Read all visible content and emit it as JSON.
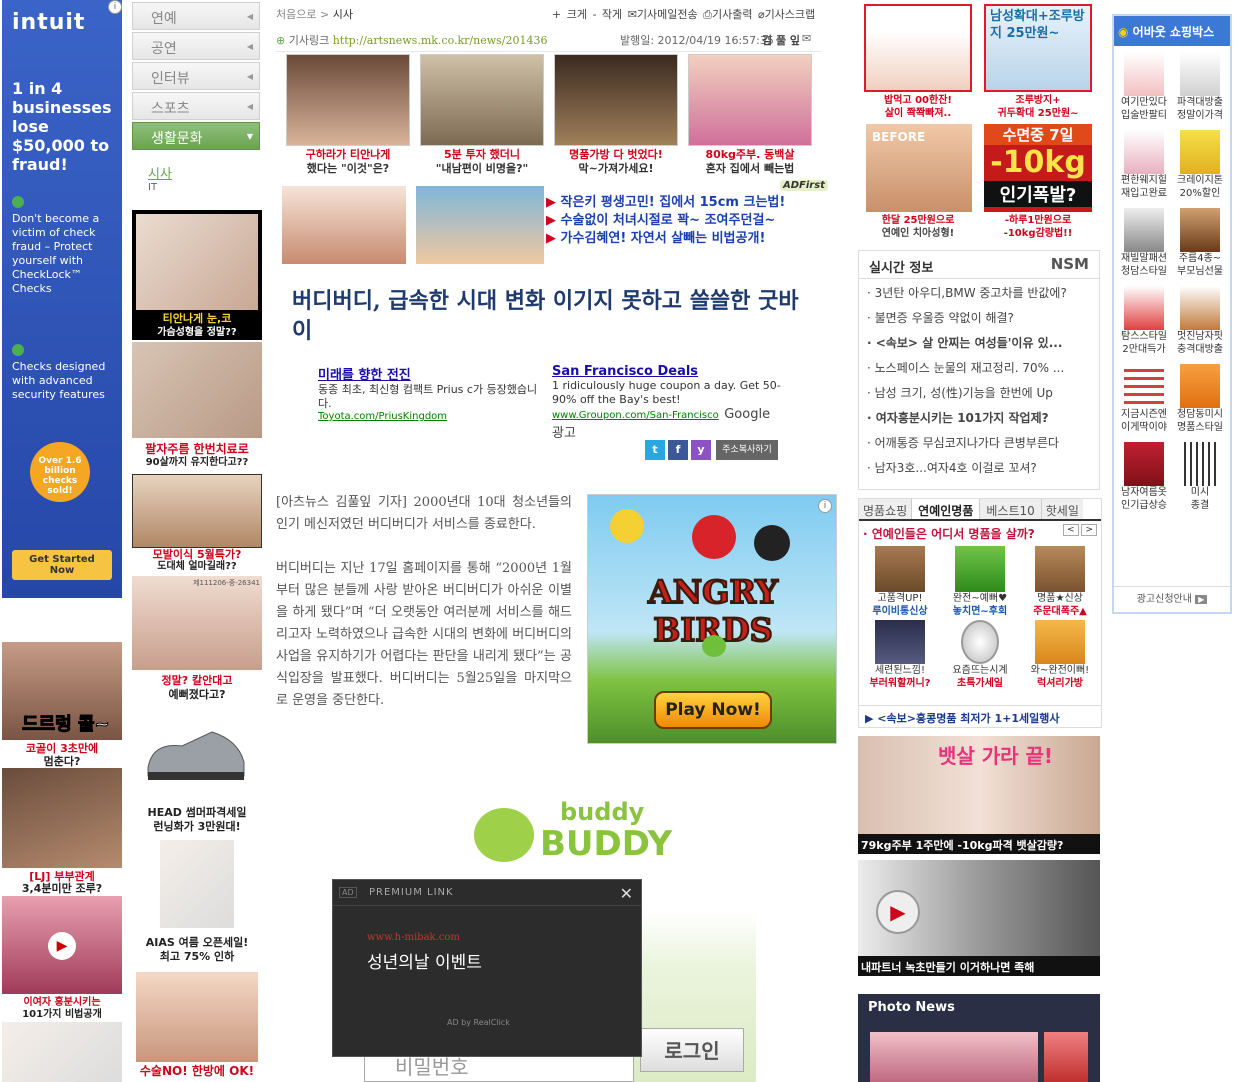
{
  "left_ad": {
    "brand": "intuit",
    "headline": "1 in 4 businesses lose $50,000 to fraud!",
    "points": [
      "Don't become a victim of check fraud – Protect yourself with CheckLock™ Checks",
      "Checks designed with advanced security features"
    ],
    "badge": "Over 1.6 billion checks sold!",
    "cta": "Get Started Now"
  },
  "left_small_ads": [
    {
      "text": "드르렁 콜~",
      "caption1": "코골이 3초만에",
      "caption2": "멈춘다?"
    },
    {
      "text": "[LJ] 부부관계",
      "caption2": "3,4분미만 조루?"
    },
    {
      "caption1": "이여자 홍분시키는",
      "caption2": "101가지 비법공개"
    }
  ],
  "nav": {
    "items": [
      "연예",
      "공연",
      "인터뷰",
      "스포츠",
      "생활문화"
    ],
    "sub": [
      "시사",
      "IT"
    ]
  },
  "col2_ads": [
    {
      "line1": "티안나게 눈,코",
      "line2": "가슴성형을 정말??"
    },
    {
      "line1": "팔자주름 한번치료로",
      "line2": "90살까지 유지한다고??"
    },
    {
      "line1": "모발이식 5월특가?",
      "line2": "도대체 얼마길래??"
    },
    {
      "line1": "정말? 칼안대고",
      "line2": "예뻐졌다고?",
      "tag": "제111206-중-26341"
    },
    {
      "line1": "HEAD 썸머파격세일",
      "line2": "런닝화가 3만원대!"
    },
    {
      "line1": "AIAS 여름 오픈세일!",
      "line2": "최고 75% 인하"
    },
    {
      "line1": "수술NO! 한방에 OK!"
    }
  ],
  "breadcrumb": {
    "home": "처음으로",
    "sep": ">",
    "current": "시사"
  },
  "toolbar": {
    "zoom_in": "+ 크게",
    "zoom_out": "- 작게",
    "email": "기사메일전송",
    "print": "기사출력",
    "scrap": "기사스크랩"
  },
  "source": {
    "label": "기사링크",
    "url": "http://artsnews.mk.co.kr/news/201436",
    "date": "발행일: 2012/04/19 16:57:35",
    "author": "김 풀 잎"
  },
  "thumbs": [
    {
      "line1": "구하라가 티안나게",
      "line2": "했다는 \"이것\"은?"
    },
    {
      "line1": "5분 투자 했더니",
      "line2": "\"내남편이 비명을?\""
    },
    {
      "line1": "명품가방 다 벗었다!",
      "line2": "막~가져가세요!"
    },
    {
      "line1": "80kg주부. 동백살",
      "line2": "혼자 집에서 빼는법"
    }
  ],
  "adfirst": {
    "logo": "ADFirst",
    "links": [
      "작은키 평생고민! 집에서 15cm 크는법!",
      "수술없이 처녀시절로 꽉~ 조여주던걸~",
      "가수김혜연! 자연서 살빼는 비법공개!"
    ]
  },
  "headline": "버디버디, 급속한 시대 변화 이기지 못하고 쓸쓸한 굿바이",
  "google_ads": {
    "items": [
      {
        "title": "미래를 향한 전진",
        "body": "동종 최초, 최신형 컴팩트 Prius c가 등장했습니다.",
        "url": "Toyota.com/PriusKingdom"
      },
      {
        "title": "San Francisco Deals",
        "body": "1 ridiculously huge coupon a day. Get 50-90% off the Bay's best!",
        "url": "www.Groupon.com/San-Francisco"
      }
    ],
    "brand": "Google 광고"
  },
  "share": {
    "copy_url": "주소복사하기"
  },
  "article_body": [
    "[아츠뉴스 김풀잎 기자] 2000년대 10대 청소년들의 인기 메신저였던 버디버디가 서비스를 종료한다.",
    "버디버디는 지난 17일 홈페이지를 통해 “2000년 1월부터 많은 분들께 사랑 받아온 버디버디가 아쉬운 이별을 하게 됐다”며 “더 오랫동안 여러분께 서비스를 해드리고자 노력하였으나 급속한 시대의 변화에 버디버디의 사업을 유지하기가 어렵다는 판단을 내리게 됐다”는 공식입장을 발표했다. 버디버디는 5월25일을 마지막으로 운영을 중단한다."
  ],
  "angry_birds": {
    "title": "ANGRY BIRDS",
    "cta": "Play Now!"
  },
  "buddy": {
    "logo1": "buddy",
    "logo2": "BUDDY",
    "password_placeholder": "비밀번호",
    "login": "로그인"
  },
  "popup": {
    "header": "PREMIUM LINK",
    "url": "www.h-mibak.com",
    "title": "성년의날 이벤트",
    "footer": "AD by RealClick",
    "close": "✕"
  },
  "right_top_ads": [
    {
      "line1": "밥먹고 00한잔!",
      "line2": "살이 쫙쫙빠져.."
    },
    {
      "line1": "조루방지+",
      "line2": "귀두확대 25만원~",
      "promo": "남성확대+조루방지 25만원~"
    },
    {
      "line1": "한달 25만원으로",
      "line2": "연예인 치아성형!",
      "promo": "BEFORE"
    },
    {
      "line1": "-하루1만원으로",
      "line2": "-10kg감량법!!",
      "promo1": "수면중 7일",
      "promo2": "-10kg",
      "promo3": "인기폭발?"
    }
  ],
  "realtime": {
    "title": "실시간 정보",
    "logo": "NSM",
    "items": [
      "3년탄 아우디,BMW 중고차를 반값에?",
      "불면증 우울증 약없이 해결?",
      "<속보> 살 안찌는 여성들'이유 있...",
      "노스페이스 눈물의 재고정리. 70% ...",
      "남성 크기, 성(性)기능을 한번에 Up",
      "여자흥분시키는 101가지 작업제?",
      "어깨통증 무심코지나가다 큰병부른다",
      "남자3호...여자4호 이걸로 꼬셔?"
    ]
  },
  "shop_tabs": {
    "tabs": [
      "명품쇼핑",
      "연예인명품",
      "베스트10",
      "핫세일"
    ],
    "banner": "· 연예인들은 어디서 명품을 살까?",
    "items": [
      {
        "line1": "고품격UP!",
        "line2": "루이비통신상"
      },
      {
        "line1": "완전~예뻐♥",
        "line2": "놓치면~후회"
      },
      {
        "line1": "명품★신상",
        "line2": "주문대폭주▲"
      },
      {
        "line1": "세련된느낌!",
        "line2": "부러워할꺼니?"
      },
      {
        "line1": "요즘뜨는시계",
        "line2": "초특가세일"
      },
      {
        "line1": "와~완전이뻐!",
        "line2": "럭셔리가방"
      }
    ],
    "footer": "▶ <속보>홍콩명품 최저가 1+1세일행사"
  },
  "diet_ads": [
    {
      "text": "79kg주부 1주만에 -10kg파격 뱃살감량?",
      "overlay": "뱃살 가라 끝!"
    },
    {
      "text": "내파트너 녹초만들기 이거하나면 족해"
    }
  ],
  "photo_news": {
    "title": "Photo News"
  },
  "shopbox": {
    "title": "어바웃 쇼핑박스",
    "items": [
      {
        "line1": "여기만있다",
        "line2": "입술반팔티"
      },
      {
        "line1": "파격대방출",
        "line2": "정말이가격"
      },
      {
        "line1": "편한웨지힐",
        "line2": "재입고완료"
      },
      {
        "line1": "크레이지톤",
        "line2": "20%할인"
      },
      {
        "line1": "재빌말패션",
        "line2": "청담스타일"
      },
      {
        "line1": "주름4종~",
        "line2": "부모님선물"
      },
      {
        "line1": "탐스스타일",
        "line2": "2만대득가"
      },
      {
        "line1": "멋진남자핏",
        "line2": "충격대방출"
      },
      {
        "line1": "지금시즌엔",
        "line2": "이게딱이야"
      },
      {
        "line1": "청담동미시",
        "line2": "명품스타일"
      },
      {
        "line1": "남자여름옷",
        "line2": "인기급상승"
      },
      {
        "line1": "미시",
        "line2": "종결"
      }
    ],
    "footer": "광고신청안내"
  }
}
